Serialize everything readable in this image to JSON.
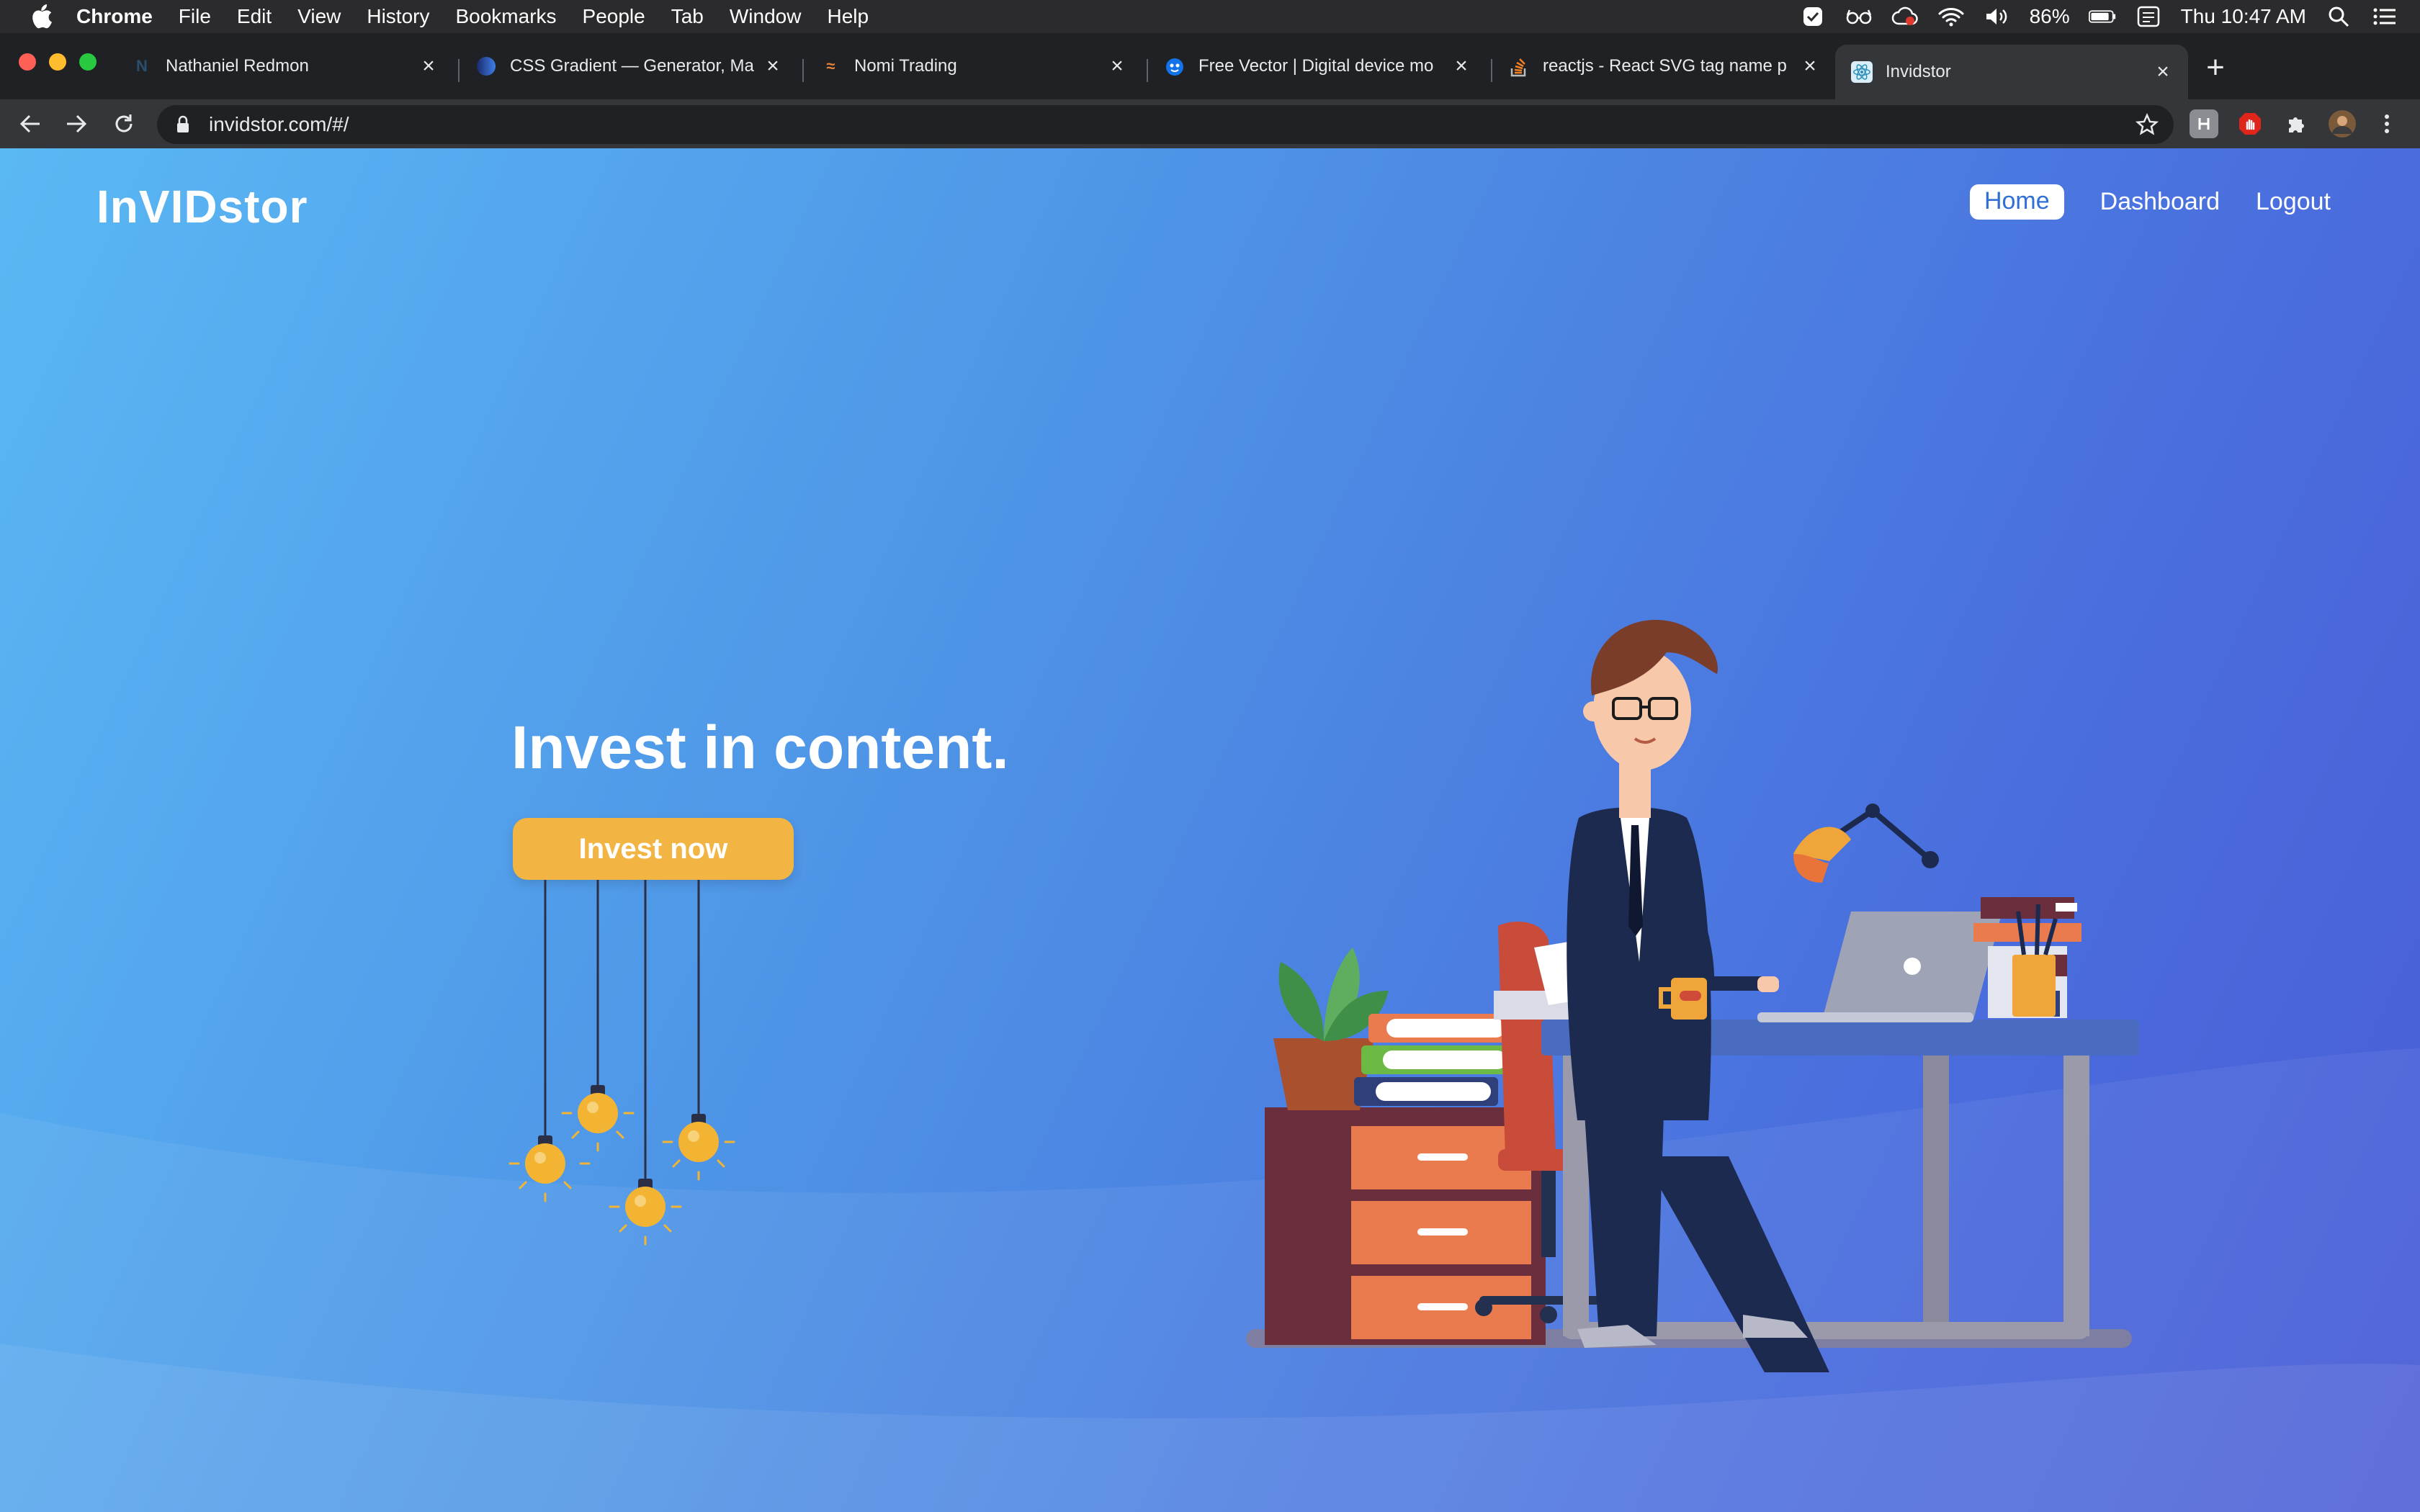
{
  "menubar": {
    "app": "Chrome",
    "items": [
      "File",
      "Edit",
      "View",
      "History",
      "Bookmarks",
      "People",
      "Tab",
      "Window",
      "Help"
    ],
    "battery": "86%",
    "clock": "Thu 10:47 AM"
  },
  "tabs": [
    {
      "title": "Nathaniel Redmon",
      "icon": "notion-n-icon",
      "active": false
    },
    {
      "title": "CSS Gradient — Generator, Ma",
      "icon": "gradient-circle-icon",
      "active": false
    },
    {
      "title": "Nomi Trading",
      "icon": "nomi-icon",
      "active": false
    },
    {
      "title": "Free Vector | Digital device mo",
      "icon": "freepik-icon",
      "active": false
    },
    {
      "title": "reactjs - React SVG tag name p",
      "icon": "stackoverflow-icon",
      "active": false
    },
    {
      "title": "Invidstor",
      "icon": "react-icon",
      "active": true
    }
  ],
  "address": {
    "url": "invidstor.com/#/"
  },
  "site": {
    "brand": "InVIDstor",
    "nav": [
      {
        "label": "Home",
        "active": true
      },
      {
        "label": "Dashboard",
        "active": false
      },
      {
        "label": "Logout",
        "active": false
      }
    ],
    "hero_title": "Invest in content.",
    "cta_label": "Invest now"
  },
  "colors": {
    "gradient_start": "#5ab8f4",
    "gradient_end": "#4a5cd6",
    "cta": "#f2b544"
  }
}
